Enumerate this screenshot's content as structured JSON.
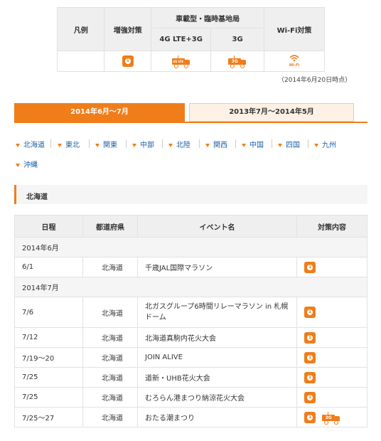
{
  "legend": {
    "label": "凡例",
    "reinforcement": "増強対策",
    "vehicle_header": "車載型・臨時基地局",
    "lte": "4G LTE+3G",
    "g3": "3G",
    "wifi": "Wi-Fi対策",
    "lte_badge": "4G LTE",
    "g3_badge": "3G",
    "wifi_caption": "Wi-Fi"
  },
  "date_note": "（2014年6月20日時点）",
  "tabs": [
    "2014年6月～7月",
    "2013年7月～2014年5月"
  ],
  "regions": [
    "北海道",
    "東北",
    "関東",
    "中部",
    "北陸",
    "関西",
    "中国",
    "四国",
    "九州",
    "沖縄"
  ],
  "section_title": "北海道",
  "table": {
    "headers": [
      "日程",
      "都道府県",
      "イベント名",
      "対策内容"
    ],
    "groups": [
      {
        "month": "2014年6月",
        "rows": [
          {
            "date": "6/1",
            "pref": "北海道",
            "name": "千歳JAL国際マラソン",
            "measures": [
              "増強対策"
            ]
          }
        ]
      },
      {
        "month": "2014年7月",
        "rows": [
          {
            "date": "7/6",
            "pref": "北海道",
            "name": "北ガスグループ6時間リレーマラソン in 札幌",
            "name2": "ドーム",
            "measures": [
              "増強対策"
            ]
          },
          {
            "date": "7/12",
            "pref": "北海道",
            "name": "北海道真駒内花火大会",
            "measures": [
              "増強対策"
            ]
          },
          {
            "date": "7/19～20",
            "pref": "北海道",
            "name": "JOIN ALIVE",
            "measures": [
              "増強対策"
            ]
          },
          {
            "date": "7/25",
            "pref": "北海道",
            "name": "道新・UHB花火大会",
            "measures": [
              "増強対策"
            ]
          },
          {
            "date": "7/25",
            "pref": "北海道",
            "name": "むろらん港まつり納涼花火大会",
            "measures": [
              "増強対策"
            ]
          },
          {
            "date": "7/25～27",
            "pref": "北海道",
            "name": "おたる潮まつり",
            "measures": [
              "増強対策",
              "3G"
            ]
          }
        ]
      }
    ]
  },
  "colors": {
    "accent": "#f07d1a",
    "link": "#1a5ea8",
    "header_bg": "#efefef"
  }
}
